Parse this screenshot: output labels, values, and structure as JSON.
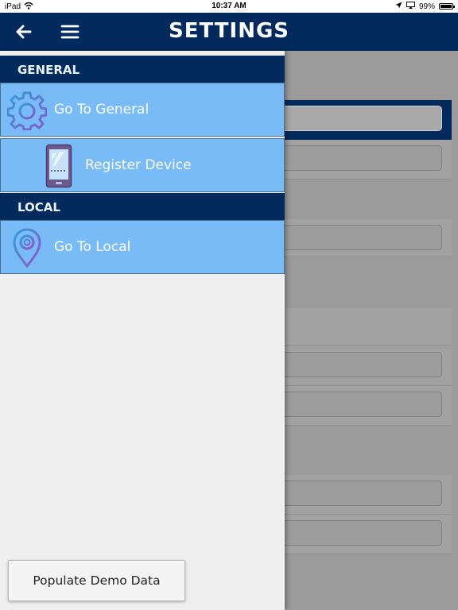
{
  "status_bar": {
    "device": "iPad",
    "time": "10:37 AM",
    "battery": "99%",
    "battery_level": 0.99
  },
  "header": {
    "title": "SETTINGS",
    "back_icon": "back-arrow-icon",
    "menu_icon": "hamburger-menu-icon"
  },
  "drawer": {
    "sections": [
      {
        "title": "GENERAL",
        "items": [
          {
            "label": "Go To General",
            "icon": "gear-icon"
          },
          {
            "label": "Register Device",
            "icon": "tablet-device-icon"
          }
        ]
      },
      {
        "title": "LOCAL",
        "items": [
          {
            "label": "Go To Local",
            "icon": "location-pin-icon"
          }
        ]
      }
    ],
    "demo_button_label": "Populate Demo Data"
  },
  "colors": {
    "header_bg": "#022a5c",
    "item_bg": "#78bbf7",
    "drawer_bg": "#efefef"
  }
}
